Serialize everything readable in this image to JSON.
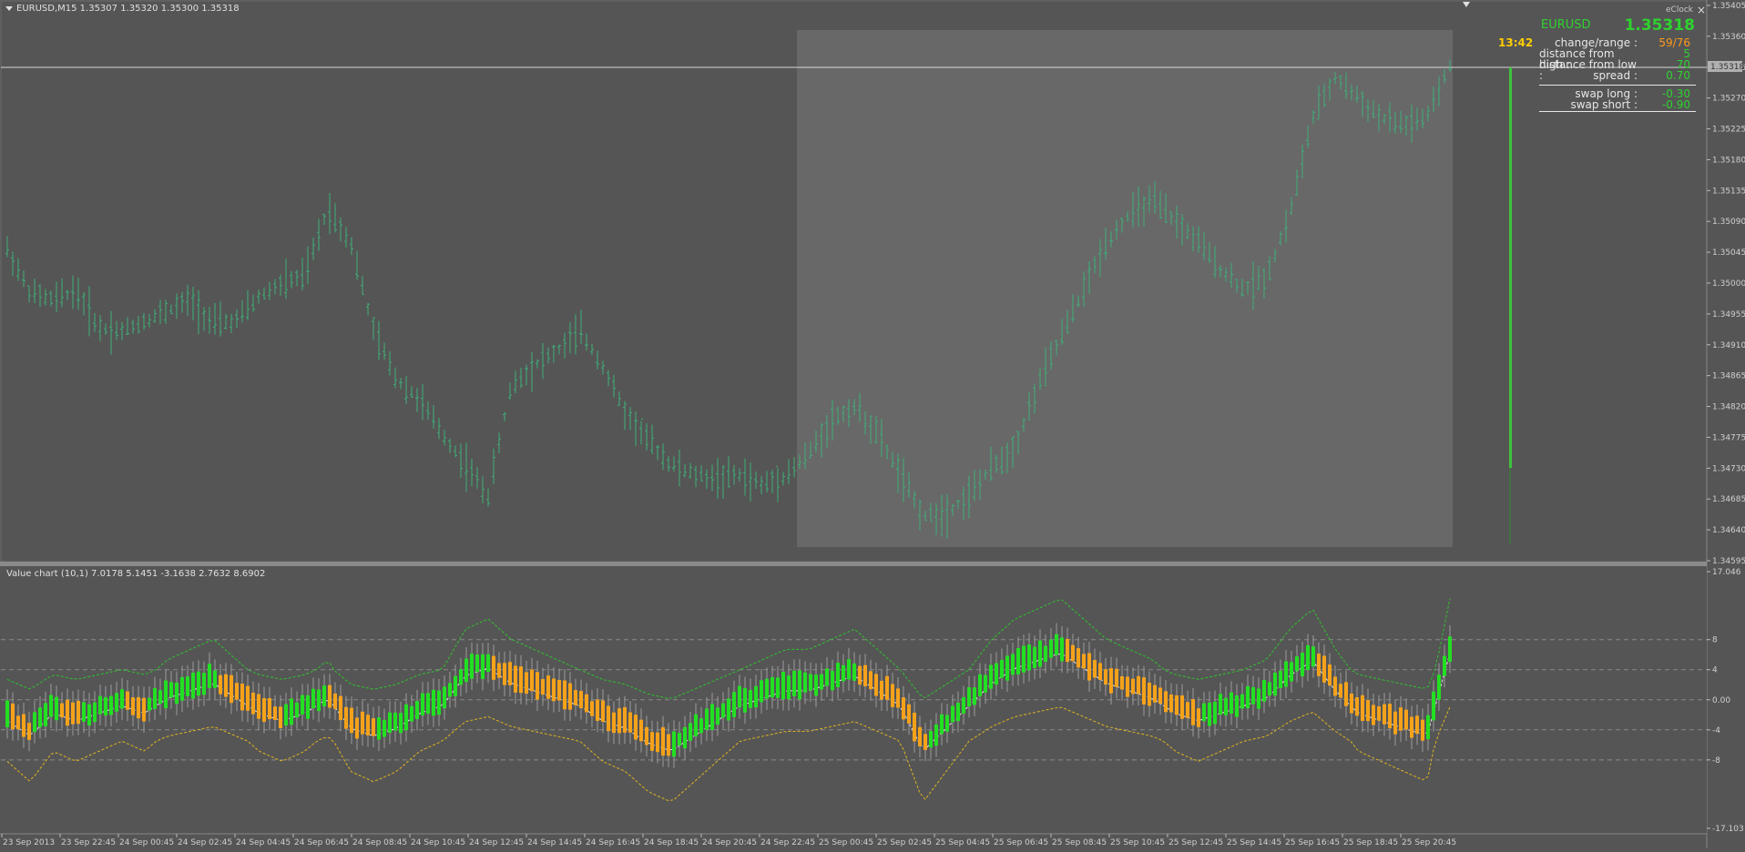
{
  "header": {
    "symbol_line": "EURUSD,M15  1.35307 1.35320 1.35300 1.35318"
  },
  "clock": {
    "time": "13:42"
  },
  "panel": {
    "brand": "eClock",
    "close_glyph": "×",
    "symbol": "EURUSD",
    "price": "1.35318",
    "rows": [
      {
        "label": "change/range :",
        "value": "59/76",
        "color": "#ff9a1a"
      },
      {
        "label": "distance from high :",
        "value": "5",
        "color": "#2fd12f"
      },
      {
        "label": "distance from low :",
        "value": "70",
        "color": "#2fd12f"
      },
      {
        "label": "spread :",
        "value": "0.70",
        "color": "#2fd12f"
      },
      {
        "label": "swap long :",
        "value": "-0.30",
        "color": "#2fd12f"
      },
      {
        "label": "swap short :",
        "value": "-0.90",
        "color": "#2fd12f"
      }
    ]
  },
  "price_axis": {
    "ticks": [
      "1.35405",
      "1.35360",
      "1.35315",
      "1.35270",
      "1.35225",
      "1.35180",
      "1.35135",
      "1.35090",
      "1.35045",
      "1.35000",
      "1.34955",
      "1.34910",
      "1.34865",
      "1.34820",
      "1.34775",
      "1.34730",
      "1.34685",
      "1.34640",
      "1.34595"
    ],
    "current_label": "1.35318"
  },
  "indicator": {
    "header": "Value chart (10,1) 7.0178 5.1451 -3.1638 2.7632 8.6902",
    "axis_ticks": [
      "17.046",
      "8",
      "4",
      "0.00",
      "-4",
      "-8",
      "-17.103"
    ]
  },
  "time_axis": {
    "ticks": [
      "23 Sep 2013",
      "23 Sep 22:45",
      "24 Sep 00:45",
      "24 Sep 02:45",
      "24 Sep 04:45",
      "24 Sep 06:45",
      "24 Sep 08:45",
      "24 Sep 10:45",
      "24 Sep 12:45",
      "24 Sep 14:45",
      "24 Sep 16:45",
      "24 Sep 18:45",
      "24 Sep 20:45",
      "24 Sep 22:45",
      "25 Sep 00:45",
      "25 Sep 02:45",
      "25 Sep 04:45",
      "25 Sep 06:45",
      "25 Sep 08:45",
      "25 Sep 10:45",
      "25 Sep 12:45",
      "25 Sep 14:45",
      "25 Sep 16:45",
      "25 Sep 18:45",
      "25 Sep 20:45"
    ]
  },
  "chart_data": {
    "type": "line",
    "title": "EURUSD,M15",
    "price_range": [
      1.34595,
      1.35405
    ],
    "indicator_range": [
      -17.103,
      17.046
    ],
    "close_price": 1.35318,
    "bar_price_anchors": [
      1.3505,
      1.34985,
      1.34975,
      1.3499,
      1.34935,
      1.3493,
      1.34945,
      1.3496,
      1.34975,
      1.3494,
      1.34945,
      1.3498,
      1.35,
      1.3501,
      1.3511,
      1.3506,
      1.3493,
      1.3486,
      1.3483,
      1.3478,
      1.34735,
      1.3469,
      1.3485,
      1.3488,
      1.349,
      1.3493,
      1.3488,
      1.3481,
      1.3477,
      1.34735,
      1.3472,
      1.34715,
      1.3472,
      1.34705,
      1.3472,
      1.3475,
      1.348,
      1.3482,
      1.3478,
      1.3472,
      1.3466,
      1.34665,
      1.3469,
      1.3473,
      1.3476,
      1.3485,
      1.3492,
      1.3499,
      1.3506,
      1.351,
      1.3512,
      1.3509,
      1.3506,
      1.3502,
      1.3499,
      1.3501,
      1.351,
      1.3524,
      1.353,
      1.3527,
      1.3524,
      1.3523,
      1.3524,
      1.35318
    ],
    "indicator_series": [
      {
        "name": "",
        "values": [
          -2,
          -4,
          -1,
          -2,
          -1,
          0,
          -1,
          1,
          2,
          3,
          1,
          -1,
          -2,
          -1,
          1,
          -3,
          -4,
          -3,
          -1,
          0,
          4,
          5,
          3,
          2,
          1,
          0,
          -2,
          -3,
          -5,
          -6,
          -4,
          -2,
          0,
          1,
          2,
          2,
          3,
          4,
          2,
          0,
          -6,
          -3,
          0,
          3,
          5,
          6,
          7,
          5,
          3,
          2,
          1,
          -1,
          -2,
          -1,
          0,
          1,
          4,
          6,
          2,
          -1,
          -2,
          -3,
          -4,
          7
        ]
      }
    ],
    "indicator_levels": [
      8,
      4,
      0,
      -4,
      -8
    ]
  }
}
